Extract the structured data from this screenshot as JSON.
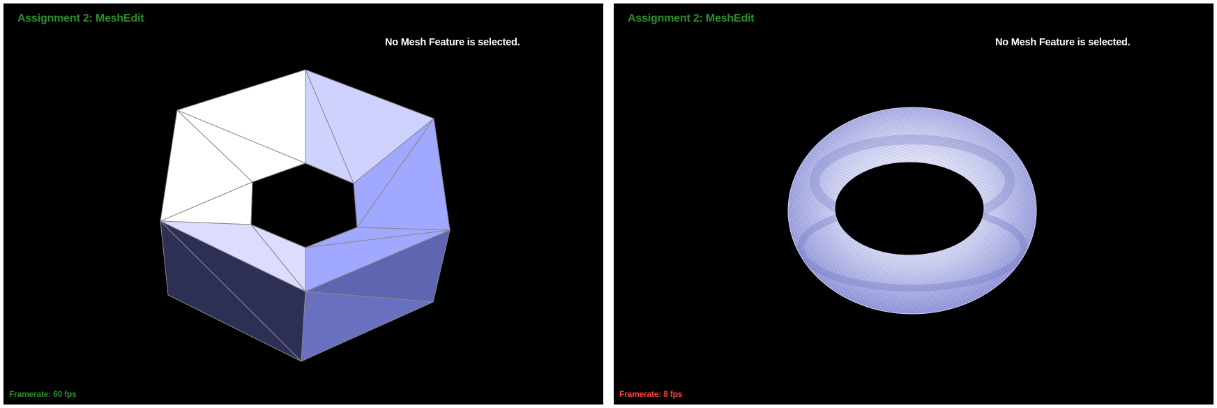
{
  "viewers": [
    {
      "title": "Assignment 2: MeshEdit",
      "status": "No Mesh Feature is selected.",
      "framerate": "Framerate: 60 fps",
      "framerate_color": "#2e8b2e",
      "mesh": "hexagonal-ring-icon"
    },
    {
      "title": "Assignment 2: MeshEdit",
      "status": "No Mesh Feature is selected.",
      "framerate": "Framerate: 8 fps",
      "framerate_color": "#ff4040",
      "mesh": "torus-icon"
    }
  ],
  "colors": {
    "background": "#000000",
    "title": "#2e8b2e",
    "status": "#ffffff",
    "mesh_light": "#ffffff",
    "mesh_mid": "#a0a8ff",
    "mesh_dark": "#2e2f55"
  }
}
